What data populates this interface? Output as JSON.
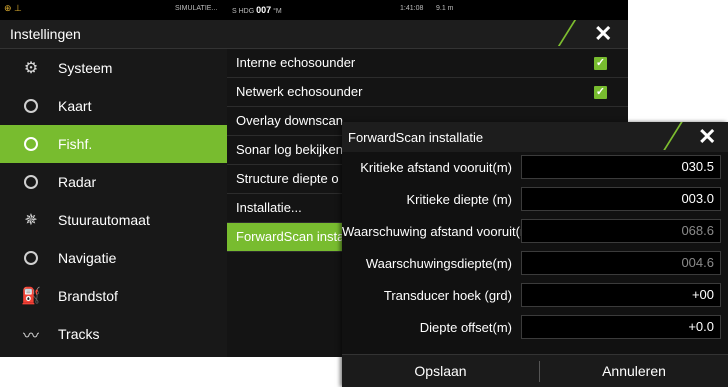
{
  "status_bar": {
    "icons": "⊕ ⊥",
    "simulation": "SIMULATIE...",
    "heading_label": "S HDG",
    "heading_value": "007",
    "heading_unit": "°M",
    "time": "1:41:08",
    "depth": "9.1 m"
  },
  "window": {
    "title": "Instellingen"
  },
  "sidebar": {
    "items": [
      {
        "label": "Systeem",
        "icon": "gear-icon"
      },
      {
        "label": "Kaart",
        "icon": "globe-icon"
      },
      {
        "label": "Fishf.",
        "icon": "sonar-icon"
      },
      {
        "label": "Radar",
        "icon": "radar-icon"
      },
      {
        "label": "Stuurautomaat",
        "icon": "helm-icon"
      },
      {
        "label": "Navigatie",
        "icon": "compass-icon"
      },
      {
        "label": "Brandstof",
        "icon": "fuel-icon"
      },
      {
        "label": "Tracks",
        "icon": "track-icon"
      }
    ],
    "active_index": 2
  },
  "settings_list": {
    "rows": [
      {
        "label": "Interne echosounder",
        "checked": true
      },
      {
        "label": "Netwerk echosounder",
        "checked": true
      },
      {
        "label": "Overlay downscan"
      },
      {
        "label": "Sonar log bekijken"
      },
      {
        "label": "Structure diepte o"
      },
      {
        "label": "Installatie..."
      },
      {
        "label": "ForwardScan insta"
      }
    ],
    "active_index": 6
  },
  "dialog": {
    "title": "ForwardScan installatie",
    "fields": [
      {
        "label": "Kritieke afstand vooruit(m)",
        "value": "030.5",
        "dim": false
      },
      {
        "label": "Kritieke diepte (m)",
        "value": "003.0",
        "dim": false
      },
      {
        "label": "Waarschuwing afstand vooruit(m)",
        "value": "068.6",
        "dim": true
      },
      {
        "label": "Waarschuwingsdiepte(m)",
        "value": "004.6",
        "dim": true
      },
      {
        "label": "Transducer hoek (grd)",
        "value": "+00",
        "dim": false
      },
      {
        "label": "Diepte offset(m)",
        "value": "+0.0",
        "dim": false
      }
    ],
    "save_label": "Opslaan",
    "cancel_label": "Annuleren"
  },
  "colors": {
    "accent": "#78bc2f",
    "background": "#141414"
  }
}
